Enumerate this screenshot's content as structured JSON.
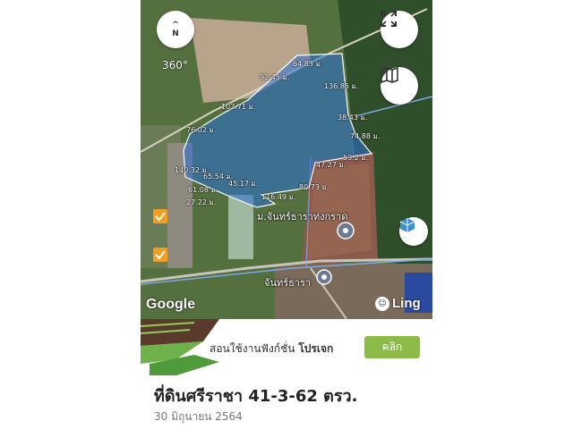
{
  "map": {
    "compass": {
      "letter_top": "^",
      "letter_bottom": "N"
    },
    "rotation_label": "360°",
    "attribution": "Google",
    "brand": "Ling",
    "place_labels": [
      "ม.จันทร์ธาราท่งกราด",
      "จันทร์ธารา"
    ],
    "measurements": [
      "64.83 ม.",
      "92.45 ม.",
      "136.85 ม.",
      "102.71 ม.",
      "38.43 ม.",
      "76.02 ม.",
      "74.88 ม.",
      "53.2 ม.",
      "47.27 ม.",
      "140.32 ม.",
      "65.54 ม.",
      "45.17 ม.",
      "80.73 ม.",
      "61.08 ม.",
      "116.49 ม.",
      "27.22 ม."
    ],
    "poly_fill": "#2a6fd6",
    "buttons": [
      "fullscreen-icon",
      "map-layers-icon",
      "3d-view-icon"
    ]
  },
  "banner": {
    "text": "สอนใช้งานฟังก์ชั่น",
    "bold": "โปรเจก",
    "button_label": "คลิก",
    "button_color": "#8dbb4a"
  },
  "listing": {
    "title": "ที่ดินศรีราชา 41-3-62 ตรว.",
    "date": "30 มิถุนายน 2564"
  }
}
